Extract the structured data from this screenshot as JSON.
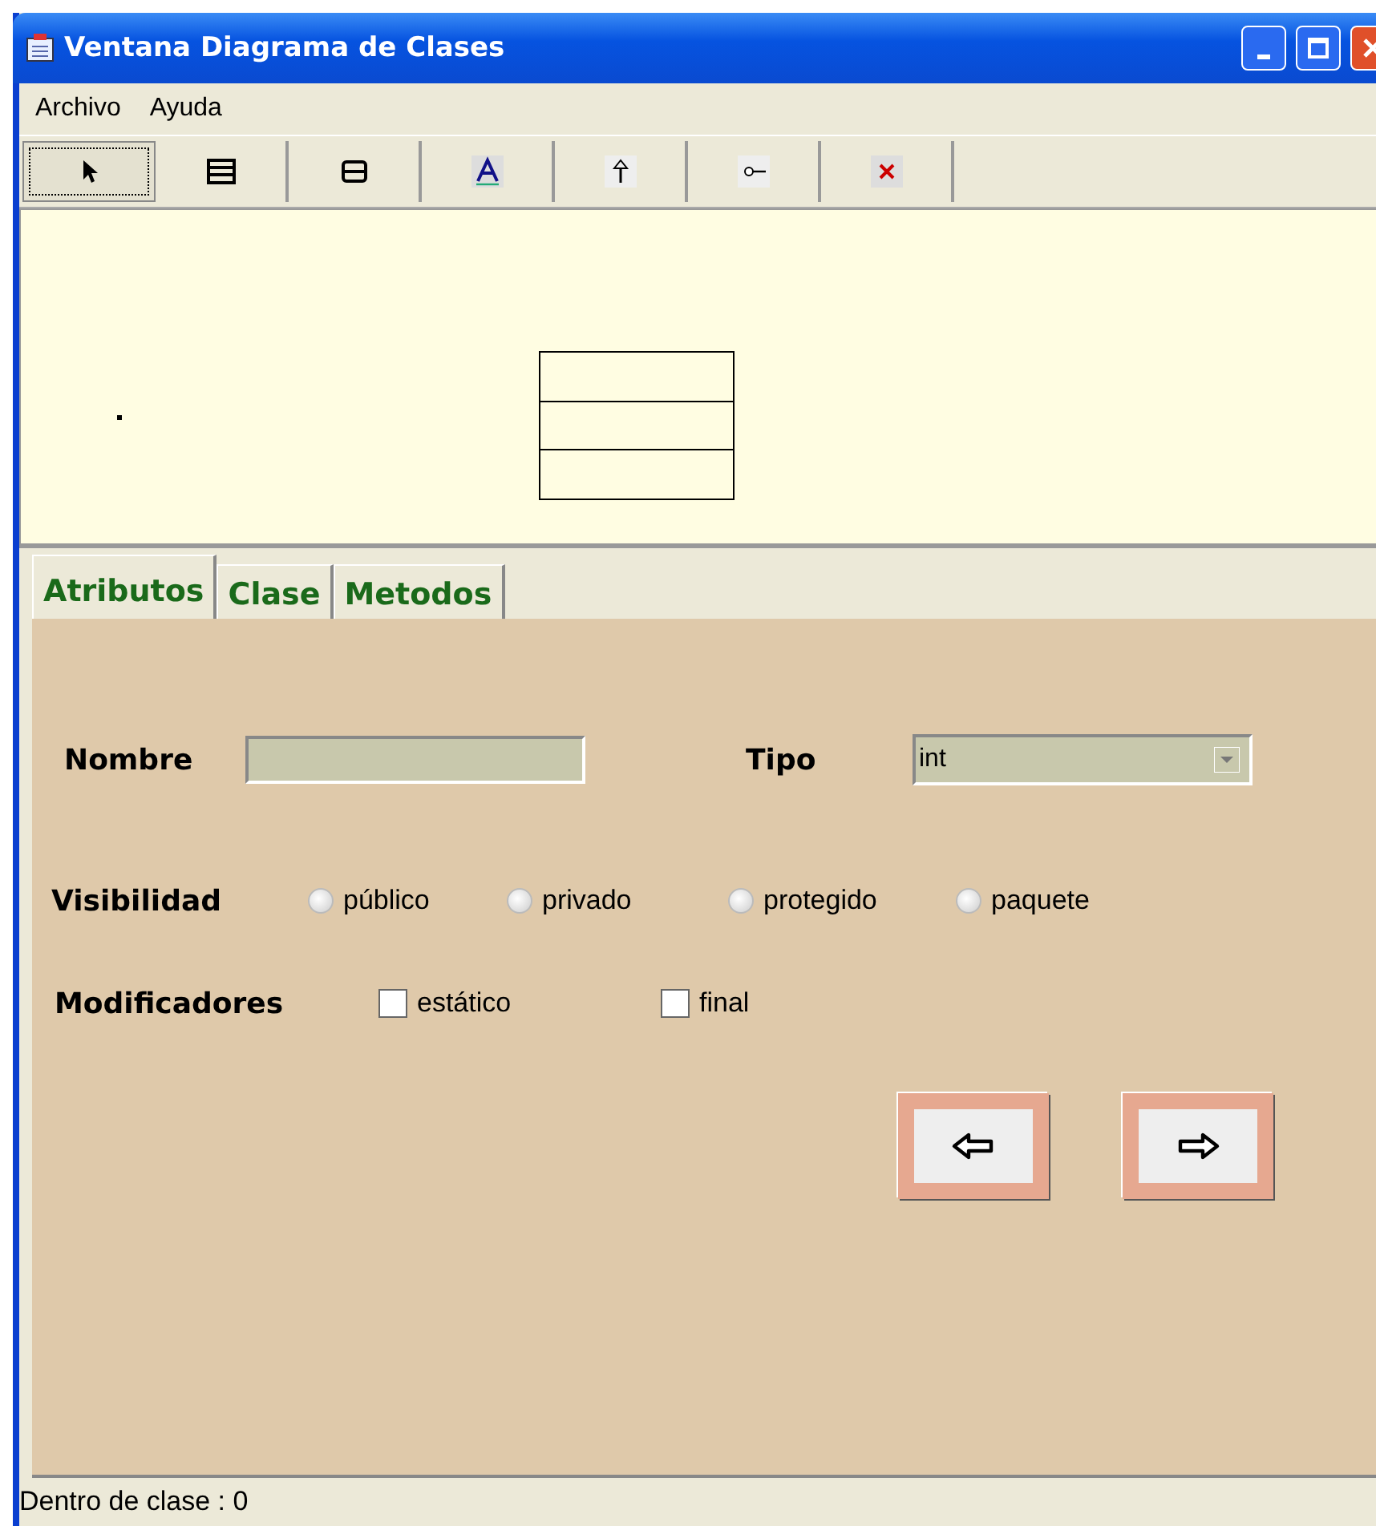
{
  "window": {
    "title": "Ventana Diagrama de Clases"
  },
  "menu": [
    "Archivo",
    "Ayuda"
  ],
  "tools": [
    {
      "kind": "pointer",
      "selected": true
    },
    {
      "kind": "class3",
      "selected": false
    },
    {
      "kind": "class2",
      "selected": false
    },
    {
      "kind": "text",
      "selected": false
    },
    {
      "kind": "inherit",
      "selected": false
    },
    {
      "kind": "assoc",
      "selected": false
    },
    {
      "kind": "delete",
      "selected": false
    }
  ],
  "tabs": [
    {
      "label": "Atributos",
      "selected": true
    },
    {
      "label": "Clase",
      "selected": false
    },
    {
      "label": "Metodos",
      "selected": false
    }
  ],
  "form": {
    "name_label": "Nombre",
    "type_label": "Tipo",
    "type_value": "int",
    "visibility_label": "Visibilidad",
    "visibility": [
      {
        "label": "público",
        "selected": false
      },
      {
        "label": "privado",
        "selected": false
      },
      {
        "label": "protegido",
        "selected": false
      },
      {
        "label": "paquete",
        "selected": false
      }
    ],
    "modifiers_label": "Modificadores",
    "modifiers": [
      {
        "label": "estático",
        "checked": false
      },
      {
        "label": "final",
        "checked": false
      }
    ]
  },
  "status_bar": "Dentro de clase : 0"
}
